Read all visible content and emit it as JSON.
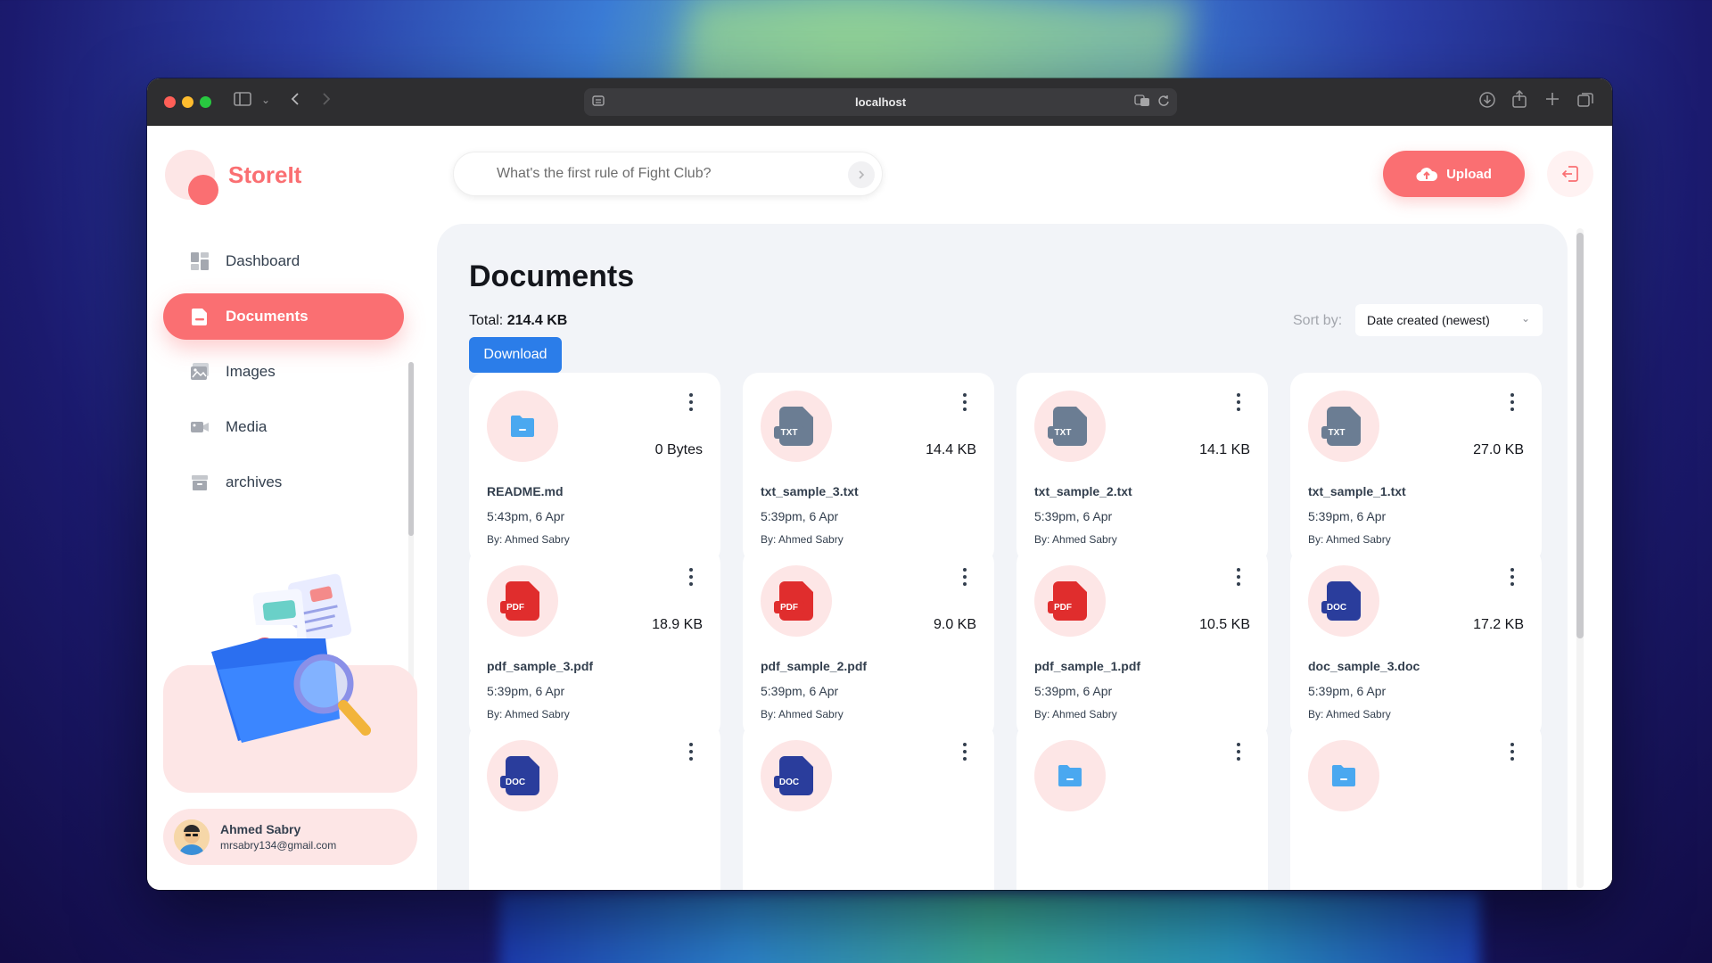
{
  "browser": {
    "url": "localhost"
  },
  "app": {
    "brand": "StoreIt",
    "search_placeholder": "What's the first rule of Fight Club?",
    "upload_label": "Upload",
    "accent_color": "#fa6f72"
  },
  "sidebar": {
    "items": [
      {
        "label": "Dashboard",
        "icon": "dashboard-icon",
        "active": false
      },
      {
        "label": "Documents",
        "icon": "documents-icon",
        "active": true
      },
      {
        "label": "Images",
        "icon": "images-icon",
        "active": false
      },
      {
        "label": "Media",
        "icon": "media-icon",
        "active": false
      },
      {
        "label": "archives",
        "icon": "archive-icon",
        "active": false
      }
    ]
  },
  "user": {
    "name": "Ahmed Sabry",
    "email": "mrsabry134@gmail.com"
  },
  "main": {
    "title": "Documents",
    "total_label": "Total:",
    "total_value": "214.4 KB",
    "download_label": "Download",
    "sort_label": "Sort by:",
    "sort_value": "Date created (newest)"
  },
  "files": [
    {
      "name": "README.md",
      "size": "0 Bytes",
      "date": "5:43pm, 6 Apr",
      "by": "By: Ahmed Sabry",
      "type": "folder"
    },
    {
      "name": "txt_sample_3.txt",
      "size": "14.4 KB",
      "date": "5:39pm, 6 Apr",
      "by": "By: Ahmed Sabry",
      "type": "txt"
    },
    {
      "name": "txt_sample_2.txt",
      "size": "14.1 KB",
      "date": "5:39pm, 6 Apr",
      "by": "By: Ahmed Sabry",
      "type": "txt"
    },
    {
      "name": "txt_sample_1.txt",
      "size": "27.0 KB",
      "date": "5:39pm, 6 Apr",
      "by": "By: Ahmed Sabry",
      "type": "txt"
    },
    {
      "name": "pdf_sample_3.pdf",
      "size": "18.9 KB",
      "date": "5:39pm, 6 Apr",
      "by": "By: Ahmed Sabry",
      "type": "pdf"
    },
    {
      "name": "pdf_sample_2.pdf",
      "size": "9.0 KB",
      "date": "5:39pm, 6 Apr",
      "by": "By: Ahmed Sabry",
      "type": "pdf"
    },
    {
      "name": "pdf_sample_1.pdf",
      "size": "10.5 KB",
      "date": "5:39pm, 6 Apr",
      "by": "By: Ahmed Sabry",
      "type": "pdf"
    },
    {
      "name": "doc_sample_3.doc",
      "size": "17.2 KB",
      "date": "5:39pm, 6 Apr",
      "by": "By: Ahmed Sabry",
      "type": "doc"
    },
    {
      "name": "",
      "size": "",
      "date": "",
      "by": "",
      "type": "doc"
    },
    {
      "name": "",
      "size": "",
      "date": "",
      "by": "",
      "type": "doc"
    },
    {
      "name": "",
      "size": "",
      "date": "",
      "by": "",
      "type": "folder"
    },
    {
      "name": "",
      "size": "",
      "date": "",
      "by": "",
      "type": "folder"
    }
  ],
  "file_type_colors": {
    "txt": "#6b7d93",
    "pdf": "#e02d2d",
    "doc": "#2a3d9c",
    "folder": "#4aa8f0"
  },
  "file_type_tags": {
    "txt": "TXT",
    "pdf": "PDF",
    "doc": "DOC"
  }
}
